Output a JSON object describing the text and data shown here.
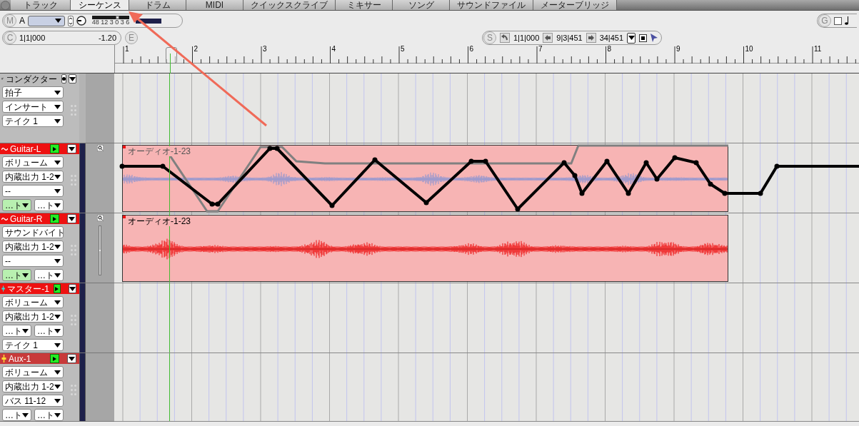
{
  "tabs": [
    {
      "label": "トラック",
      "selected": false
    },
    {
      "label": "シーケンス",
      "selected": true
    },
    {
      "label": "ドラム",
      "selected": false
    },
    {
      "label": "MIDI",
      "selected": false
    },
    {
      "label": "クイックスクライブ",
      "selected": false
    },
    {
      "label": "ミキサー",
      "selected": false
    },
    {
      "label": "ソング",
      "selected": false
    },
    {
      "label": "サウンドファイル",
      "selected": false
    },
    {
      "label": "メーターブリッジ",
      "selected": false
    }
  ],
  "mixer_bar": {
    "badge": "M",
    "channel": "A",
    "meter_scale": "48 12 3 0 3 6",
    "level": 0.7
  },
  "counter_bar": {
    "badge": "C",
    "position": "1|1|000",
    "value": "-1.20",
    "edit_badge": "E"
  },
  "locate_bar": {
    "badge": "S",
    "start": "1|1|000",
    "current": "9|3|451",
    "end": "34|451"
  },
  "grid_bar": {
    "badge": "G",
    "checked": false
  },
  "ruler": {
    "bars": [
      "1",
      "2",
      "3",
      "4",
      "5",
      "6",
      "7",
      "8",
      "9",
      "10",
      "11"
    ]
  },
  "tracks": [
    {
      "kind": "conductor",
      "name": "コンダクター",
      "rows": [
        [
          {
            "label": "拍子",
            "highlighted": false
          }
        ],
        [
          {
            "label": "インサート",
            "highlighted": false
          }
        ],
        [
          {
            "label": "テイク 1",
            "highlighted": false
          }
        ]
      ]
    },
    {
      "kind": "audio",
      "name": "Guitar-L",
      "zoom": true,
      "fader": false,
      "region": {
        "label": "オーディオ-1-23",
        "automation": true
      },
      "rows": [
        [
          {
            "label": "ボリューム",
            "highlighted": false
          }
        ],
        [
          {
            "label": "内蔵出力 1-2",
            "highlighted": false
          }
        ],
        [
          {
            "label": "--",
            "highlighted": false
          }
        ],
        [
          {
            "label": "…ト",
            "highlighted": true
          },
          {
            "label": "…ト",
            "highlighted": false
          }
        ]
      ]
    },
    {
      "kind": "audio",
      "name": "Guitar-R",
      "zoom": true,
      "fader": true,
      "region": {
        "label": "オーディオ-1-23",
        "automation": false
      },
      "rows": [
        [
          {
            "label": "サウンドバイト",
            "highlighted": false
          }
        ],
        [
          {
            "label": "内蔵出力 1-2",
            "highlighted": false
          }
        ],
        [
          {
            "label": "--",
            "highlighted": false
          }
        ],
        [
          {
            "label": "…ト",
            "highlighted": true
          },
          {
            "label": "…ト",
            "highlighted": false
          }
        ]
      ]
    },
    {
      "kind": "master",
      "name": "マスター-1",
      "zoom": false,
      "fader": false,
      "rows": [
        [
          {
            "label": "ボリューム",
            "highlighted": false
          }
        ],
        [
          {
            "label": "内蔵出力 1-2",
            "highlighted": false
          }
        ],
        [
          {
            "label": "…ト",
            "highlighted": false
          },
          {
            "label": "…ト",
            "highlighted": false
          }
        ],
        [
          {
            "label": "テイク 1",
            "highlighted": false
          }
        ]
      ]
    },
    {
      "kind": "aux",
      "name": "Aux-1",
      "zoom": false,
      "fader": false,
      "rows": [
        [
          {
            "label": "ボリューム",
            "highlighted": false
          }
        ],
        [
          {
            "label": "内蔵出力 1-2",
            "highlighted": false
          }
        ],
        [
          {
            "label": "バス 11-12",
            "highlighted": false
          }
        ],
        [
          {
            "label": "…ト",
            "highlighted": false
          },
          {
            "label": "…ト",
            "highlighted": false
          }
        ]
      ]
    }
  ]
}
